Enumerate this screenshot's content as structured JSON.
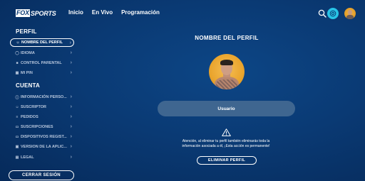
{
  "header": {
    "logo_box": "FOX",
    "logo_text": "SPORTS",
    "nav": [
      "Inicio",
      "En Vivo",
      "Programación"
    ],
    "icons": {
      "search": "search-icon",
      "help": "help-icon",
      "avatar": "avatar"
    }
  },
  "sidebar": {
    "profile_title": "PERFIL",
    "profile_items": [
      {
        "label": "NOMBRE DEL PERFIL",
        "icon": "person-icon",
        "active": true
      },
      {
        "label": "IDIOMA",
        "icon": "globe-icon"
      },
      {
        "label": "CONTROL PARENTAL",
        "icon": "lock-icon"
      },
      {
        "label": "MI PIN",
        "icon": "pin-icon"
      }
    ],
    "account_title": "CUENTA",
    "account_items": [
      {
        "label": "INFORMACIÓN PERSO...",
        "icon": "info-icon"
      },
      {
        "label": "SUSCRIPTOR",
        "icon": "person-icon"
      },
      {
        "label": "PEDIDOS",
        "icon": "list-icon"
      },
      {
        "label": "SUSCRIPCIONES",
        "icon": "card-icon"
      },
      {
        "label": "DISPOSITIVOS REGIST...",
        "icon": "device-icon"
      },
      {
        "label": "VERSION DE LA APLIC...",
        "icon": "app-icon"
      },
      {
        "label": "LEGAL",
        "icon": "document-icon"
      }
    ],
    "logout": "CERRAR SESIÓN"
  },
  "main": {
    "title": "NOMBRE DEL PERFIL",
    "username_value": "Usuario",
    "warning_line1": "Atención, al eliminar tu perfil también eliminarás toda la",
    "warning_line2": "información asociada a él, ¡Esta acción es permanente!",
    "delete_button": "ELIMINAR PERFIL"
  },
  "colors": {
    "background": "#0a3a74",
    "accent": "#27c3e6",
    "field": "#3f6690",
    "avatar": "#eaa52e"
  }
}
